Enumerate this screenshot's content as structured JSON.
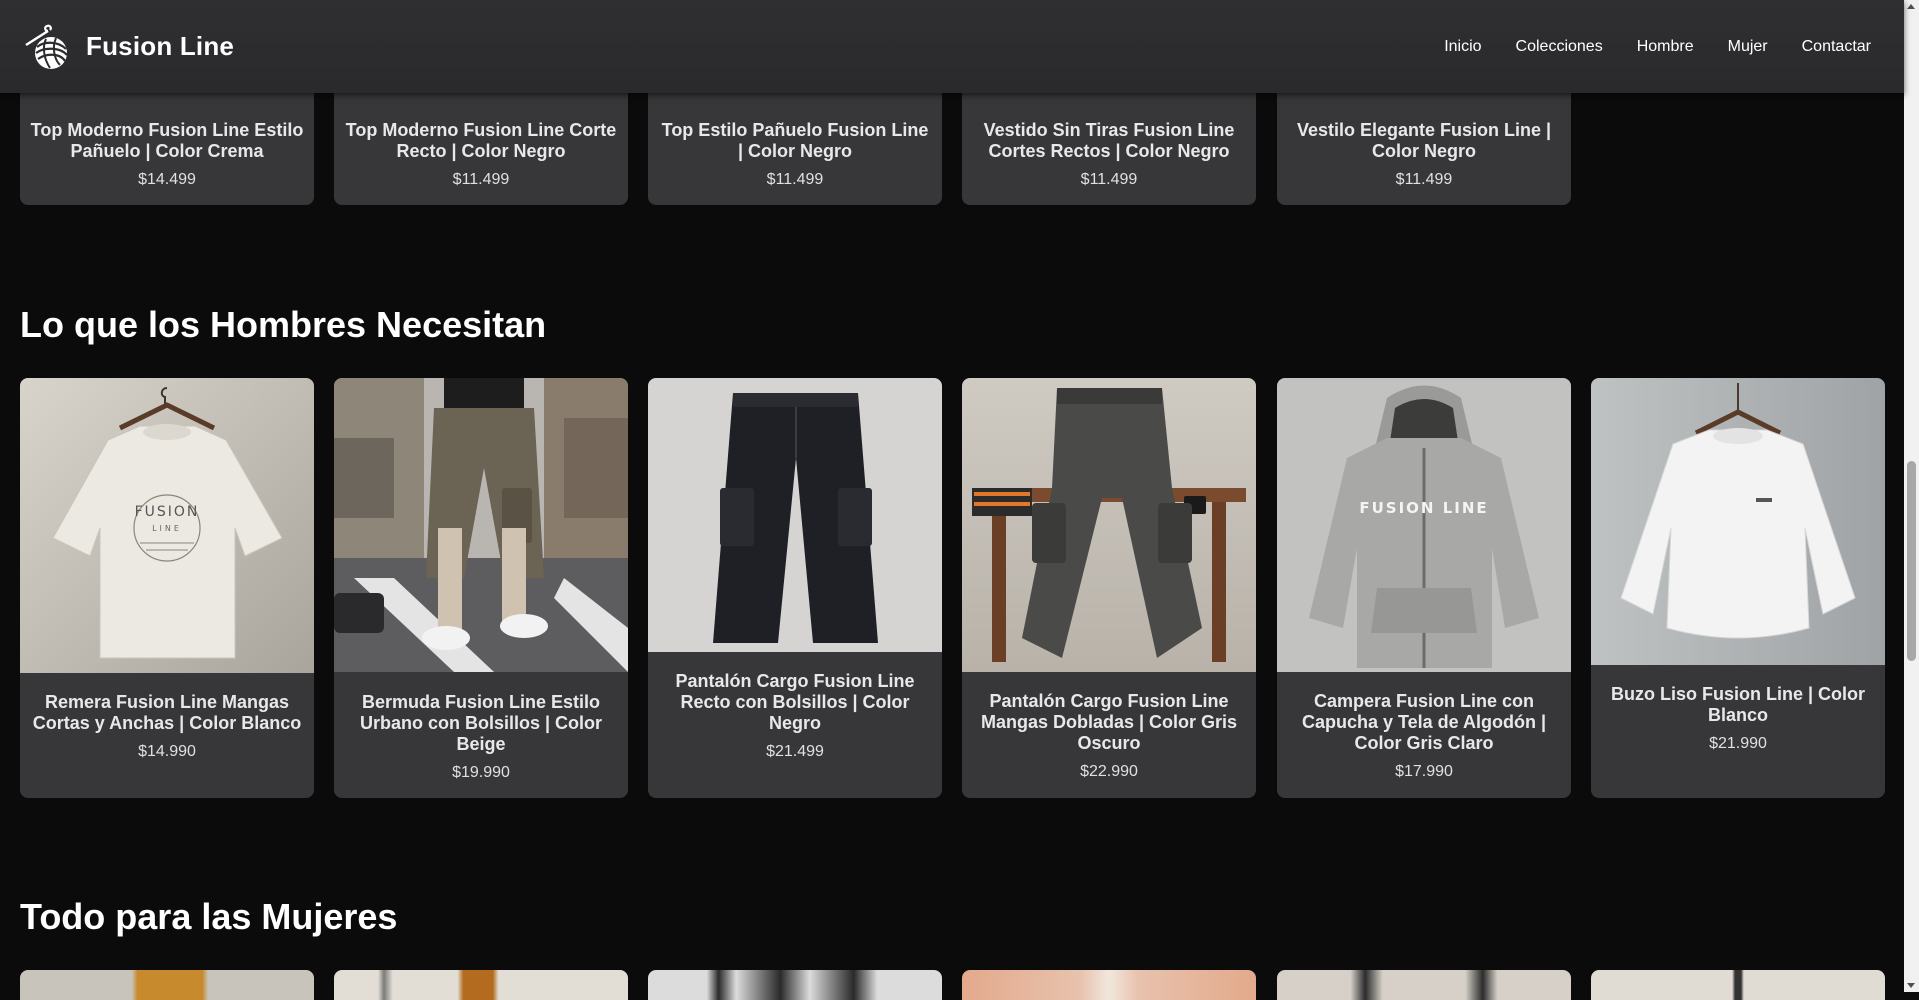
{
  "brand": {
    "name": "Fusion Line"
  },
  "nav": [
    "Inicio",
    "Colecciones",
    "Hombre",
    "Mujer",
    "Contactar"
  ],
  "top_products": [
    {
      "name": "Top Moderno Fusion Line Estilo Pañuelo | Color Crema",
      "price": "$14.499"
    },
    {
      "name": "Top Moderno Fusion Line Corte Recto | Color Negro",
      "price": "$11.499"
    },
    {
      "name": "Top Estilo Pañuelo Fusion Line | Color Negro",
      "price": "$11.499"
    },
    {
      "name": "Vestido Sin Tiras Fusion Line Cortes Rectos | Color Negro",
      "price": "$11.499"
    },
    {
      "name": "Vestilo Elegante Fusion Line | Color Negro",
      "price": "$11.499"
    }
  ],
  "men_section": {
    "title": "Lo que los Hombres Necesitan",
    "products": [
      {
        "name": "Remera Fusion Line Mangas Cortas y Anchas | Color Blanco",
        "price": "$14.990",
        "image": "white-oversized-tshirt"
      },
      {
        "name": "Bermuda Fusion Line Estilo Urbano con Bolsillos | Color Beige",
        "price": "$19.990",
        "image": "cargo-shorts-street"
      },
      {
        "name": "Pantalón Cargo Fusion Line Recto con Bolsillos | Color Negro",
        "price": "$21.499",
        "image": "black-cargo-pants"
      },
      {
        "name": "Pantalón Cargo Fusion Line Mangas Dobladas | Color Gris Oscuro",
        "price": "$22.990",
        "image": "grey-cargo-pants-stool"
      },
      {
        "name": "Campera Fusion Line con Capucha y Tela de Algodón | Color Gris Claro",
        "price": "$17.990",
        "image": "grey-zip-hoodie"
      },
      {
        "name": "Buzo Liso Fusion Line | Color Blanco",
        "price": "$21.990",
        "image": "white-sweatshirt"
      }
    ]
  },
  "women_section": {
    "title": "Todo para las Mujeres"
  },
  "colors": {
    "background": "#0b0b0c",
    "header": "#2f2f31",
    "card": "#373739"
  }
}
